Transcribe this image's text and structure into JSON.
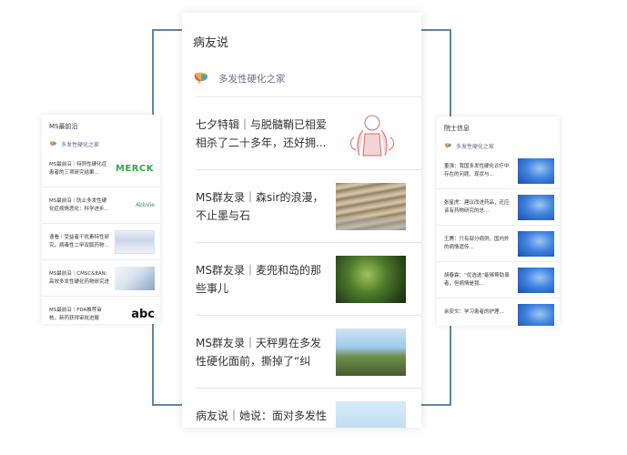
{
  "main_card": {
    "title": "病友说",
    "source": "多发性硬化之家",
    "articles": [
      {
        "title": "七夕特辑｜与脱髓鞘已相爱相杀了二十多年，还好拥..."
      },
      {
        "title": "MS群友录｜森sir的浪漫，不止墨与石"
      },
      {
        "title": "MS群友录｜麦兜和岛的那些事儿"
      },
      {
        "title": "MS群友录｜天秤男在多发性硬化面前，撕掉了“纠结..."
      },
      {
        "title": "病友说｜她说：面对多发性硬化，最值得的事是珍惜..."
      }
    ]
  },
  "left_card": {
    "title": "MS最前沿",
    "source": "多发性硬化之家",
    "articles": [
      {
        "title": "MS最前沿｜特异性硬化症患者的三项研究结果...",
        "thumb_text": "MERCK"
      },
      {
        "title": "MS最前沿｜防止多发性硬化症病情恶化：科学进步...",
        "thumb_text": "AbbVie"
      },
      {
        "title": "速看｜受益者干扰素特性研究，病毒性二甲双胍药物...",
        "thumb_text": ""
      },
      {
        "title": "MS最前沿｜CMSC&EAN:高效多发性硬化药物研究进展",
        "thumb_text": ""
      },
      {
        "title": "MS最前沿｜FDA推荐审核，新药获得审批进展",
        "thumb_text": "abc"
      }
    ]
  },
  "right_card": {
    "title": "院士信息",
    "source": "多发性硬化之家",
    "articles": [
      {
        "title": "董强：我国多发性硬化诊疗中存在的问题、现状与..."
      },
      {
        "title": "张星虎：建议改进药品，还应该有药物研究的总..."
      },
      {
        "title": "王腾：只有部分病例，国内外的病情遗传..."
      },
      {
        "title": "胡春霖：“优选选”能够帮助患者，但病情是我..."
      },
      {
        "title": "余安文：学习患者的护理..."
      }
    ]
  },
  "colors": {
    "bracket": "#5b87a6",
    "source_text": "#6f6f8e"
  }
}
